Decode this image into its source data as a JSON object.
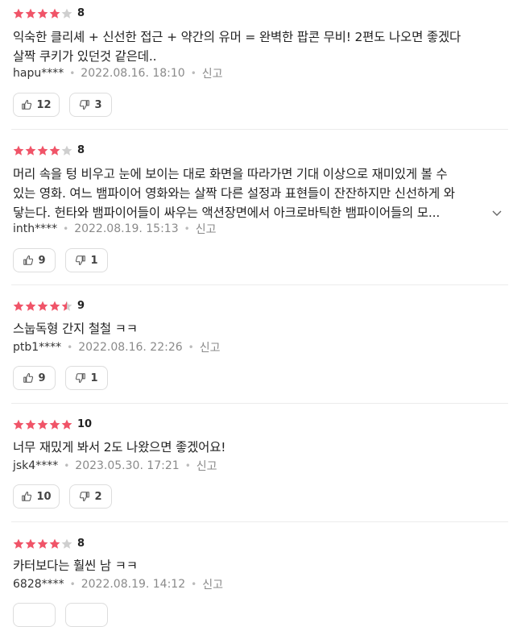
{
  "colors": {
    "star_on": "#f05468",
    "star_off": "#cfcfcf"
  },
  "reviews": [
    {
      "stars": [
        1,
        1,
        1,
        1,
        0
      ],
      "score": "8",
      "lines": [
        "익숙한 클리셰 + 신선한 접근 + 약간의 유머 = 완벽한 팝콘 무비! 2편도 나오면 좋겠다",
        "살짝 쿠키가 있던것 같은데.."
      ],
      "truncated": false,
      "user": "hapu****",
      "date": "2022.08.16. 18:10",
      "report": "신고",
      "likes": "12",
      "dislikes": "3"
    },
    {
      "stars": [
        1,
        1,
        1,
        1,
        0
      ],
      "score": "8",
      "lines": [
        "머리 속을 텅 비우고 눈에 보이는 대로 화면을 따라가면 기대 이상으로 재미있게 볼 수",
        "있는 영화. 여느 뱀파이어 영화와는 살짝 다른 설정과 표현들이 잔잔하지만 신선하게 와",
        "닿는다. 헌타와 뱀파이어들이 싸우는 액션장면에서 아크로바틱한 뱀파이어들의 모..."
      ],
      "truncated": true,
      "user": "inth****",
      "date": "2022.08.19. 15:13",
      "report": "신고",
      "likes": "9",
      "dislikes": "1"
    },
    {
      "stars": [
        1,
        1,
        1,
        1,
        0.5
      ],
      "score": "9",
      "lines": [
        "스눕독형 간지 철철 ㅋㅋ"
      ],
      "truncated": false,
      "user": "ptb1****",
      "date": "2022.08.16. 22:26",
      "report": "신고",
      "likes": "9",
      "dislikes": "1"
    },
    {
      "stars": [
        1,
        1,
        1,
        1,
        1
      ],
      "score": "10",
      "lines": [
        "너무 재밌게 봐서 2도 나왔으면 좋겠어요!"
      ],
      "truncated": false,
      "user": "jsk4****",
      "date": "2023.05.30. 17:21",
      "report": "신고",
      "likes": "10",
      "dislikes": "2"
    },
    {
      "stars": [
        1,
        1,
        1,
        1,
        0
      ],
      "score": "8",
      "lines": [
        "카터보다는 훨씬 남 ㅋㅋ"
      ],
      "truncated": false,
      "user": "6828****",
      "date": "2022.08.19. 14:12",
      "report": "신고",
      "likes": "",
      "dislikes": ""
    }
  ]
}
